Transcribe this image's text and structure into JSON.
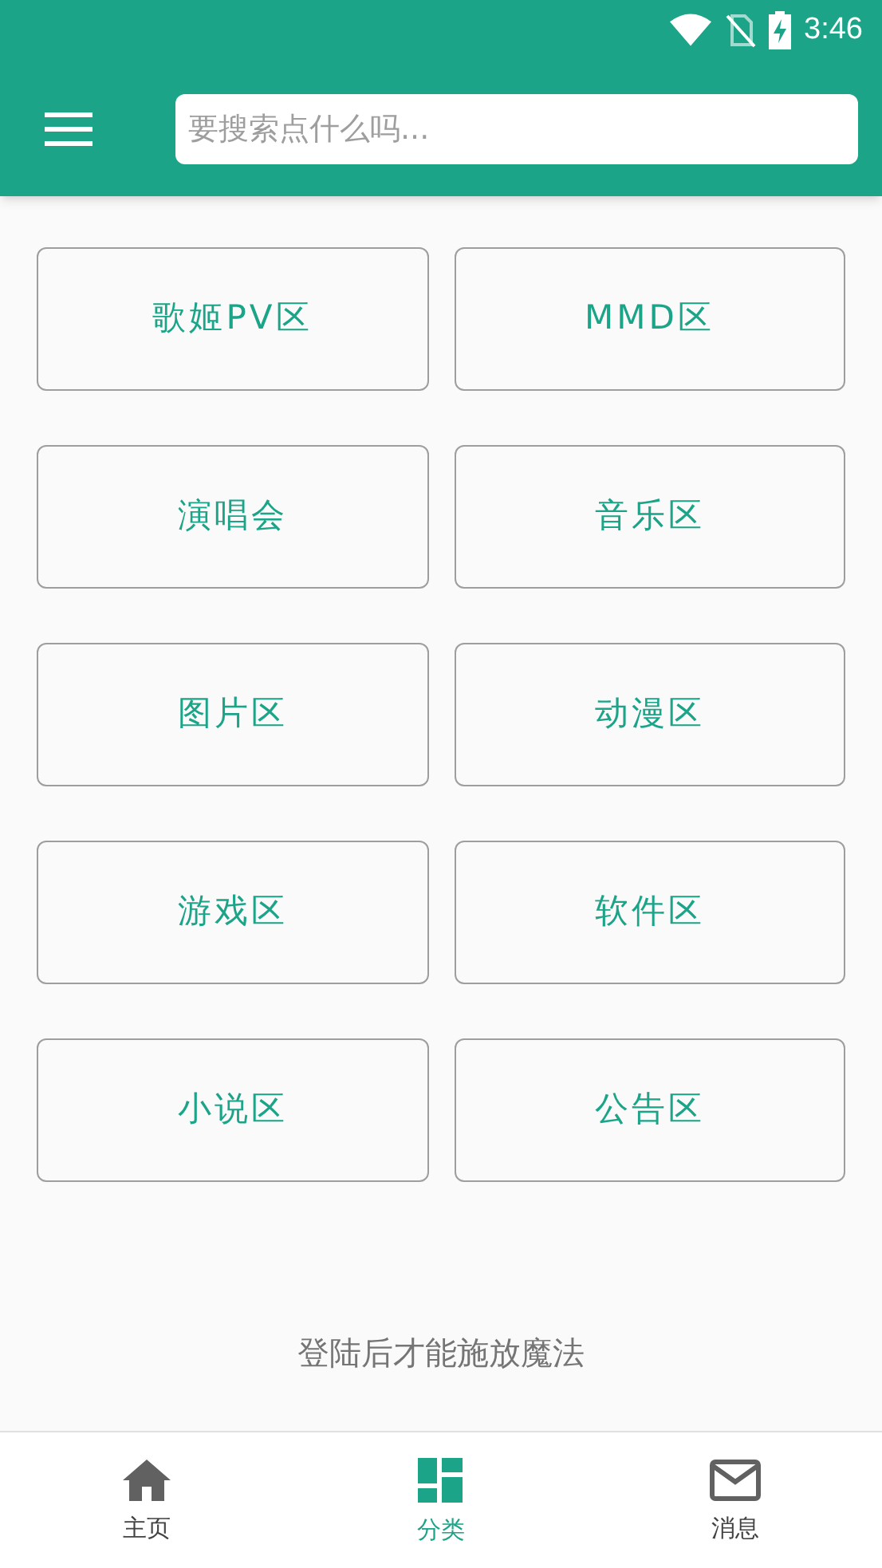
{
  "status_bar": {
    "time": "3:46"
  },
  "toolbar": {
    "search": {
      "placeholder": "要搜索点什么吗..."
    }
  },
  "categories": [
    {
      "label": "歌姬PV区"
    },
    {
      "label": "MMD区"
    },
    {
      "label": "演唱会"
    },
    {
      "label": "音乐区"
    },
    {
      "label": "图片区"
    },
    {
      "label": "动漫区"
    },
    {
      "label": "游戏区"
    },
    {
      "label": "软件区"
    },
    {
      "label": "小说区"
    },
    {
      "label": "公告区"
    }
  ],
  "login_hint": "登陆后才能施放魔法",
  "bottom_nav": [
    {
      "kind": "home",
      "label": "主页",
      "selected": false
    },
    {
      "kind": "category",
      "label": "分类",
      "selected": true
    },
    {
      "kind": "message",
      "label": "消息",
      "selected": false
    }
  ]
}
